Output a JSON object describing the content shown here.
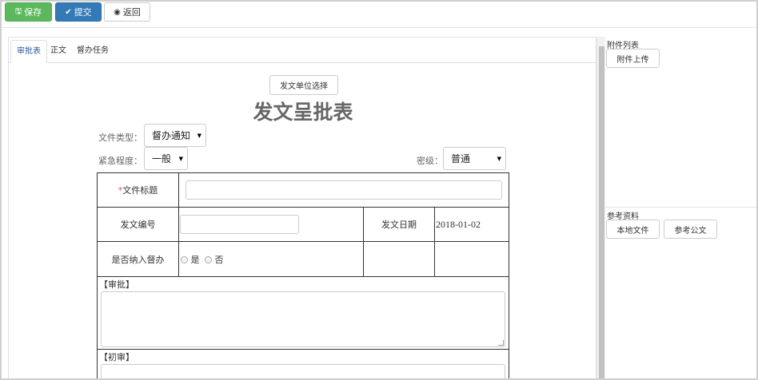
{
  "toolbar": {
    "save_label": "保存",
    "submit_label": "提交",
    "back_label": "返回"
  },
  "tabs": [
    "审批表",
    "正文",
    "督办任务"
  ],
  "form": {
    "unit_select_button": "发文单位选择",
    "title": "发文呈批表",
    "doc_type_label": "文件类型：",
    "doc_type_value": "督办通知",
    "urgency_label": "紧急程度：",
    "urgency_value": "一般",
    "secrecy_label": "密级：",
    "secrecy_value": "普通",
    "required_mark": "*",
    "doc_title_label": "文件标题",
    "doc_title_value": "",
    "doc_number_label": "发文编号",
    "doc_number_value": "",
    "issue_date_label": "发文日期",
    "issue_date_value": "2018-01-02",
    "supervise_label": "是否纳入督办",
    "supervise_yes": "是",
    "supervise_no": "否",
    "approval_section": "【审批】",
    "initial_review_section": "【初审】"
  },
  "right": {
    "attachments_title": "附件列表",
    "upload_button": "附件上传",
    "reference_title": "参考资料",
    "local_file_button": "本地文件",
    "reference_doc_button": "参考公文"
  }
}
